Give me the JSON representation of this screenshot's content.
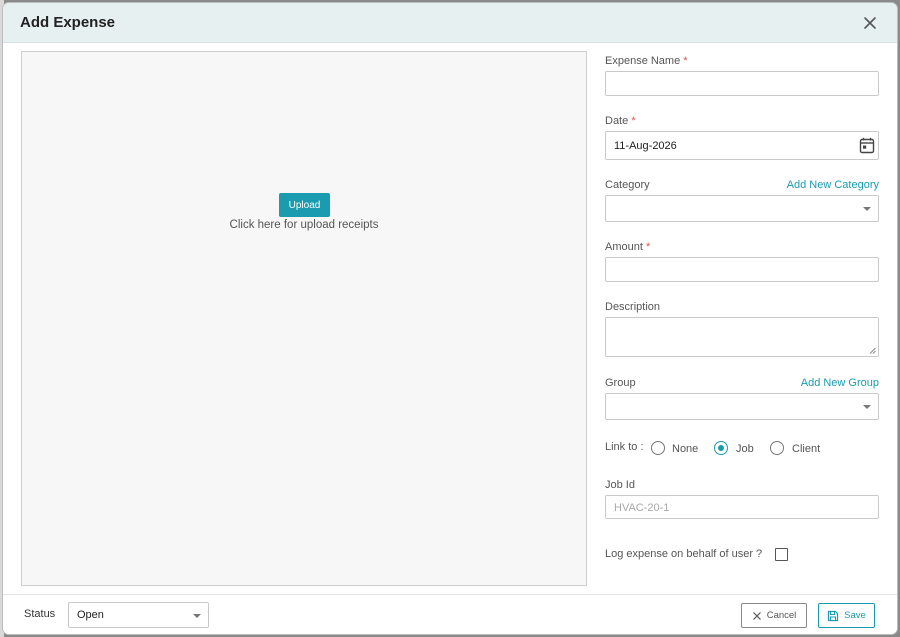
{
  "dialog": {
    "title": "Add Expense",
    "close_icon": "close-icon"
  },
  "upload": {
    "button_label": "Upload",
    "hint": "Click here for upload receipts"
  },
  "form": {
    "expense_name": {
      "label": "Expense Name",
      "required_mark": "*",
      "value": ""
    },
    "date": {
      "label": "Date",
      "required_mark": "*",
      "value": "11-Aug-2026",
      "icon": "calendar-icon"
    },
    "category": {
      "label": "Category",
      "link": "Add New Category",
      "value": "",
      "icon": "chevron-down-icon"
    },
    "amount": {
      "label": "Amount",
      "required_mark": "*",
      "value": ""
    },
    "description": {
      "label": "Description",
      "value": ""
    },
    "group": {
      "label": "Group",
      "link": "Add New Group",
      "value": "",
      "icon": "chevron-down-icon"
    },
    "link_to": {
      "label": "Link to :",
      "options": [
        "None",
        "Job",
        "Client"
      ],
      "selected": "Job"
    },
    "job_id": {
      "label": "Job Id",
      "placeholder": "HVAC-20-1"
    },
    "log_on_behalf": {
      "label": "Log expense on behalf of user ?",
      "checked": false
    }
  },
  "footer": {
    "status_label": "Status",
    "status_value": "Open",
    "cancel_label": "Cancel",
    "save_label": "Save"
  },
  "colors": {
    "accent": "#1a9bb0",
    "header_bg": "#e6f0f1",
    "required": "#d9534f"
  }
}
